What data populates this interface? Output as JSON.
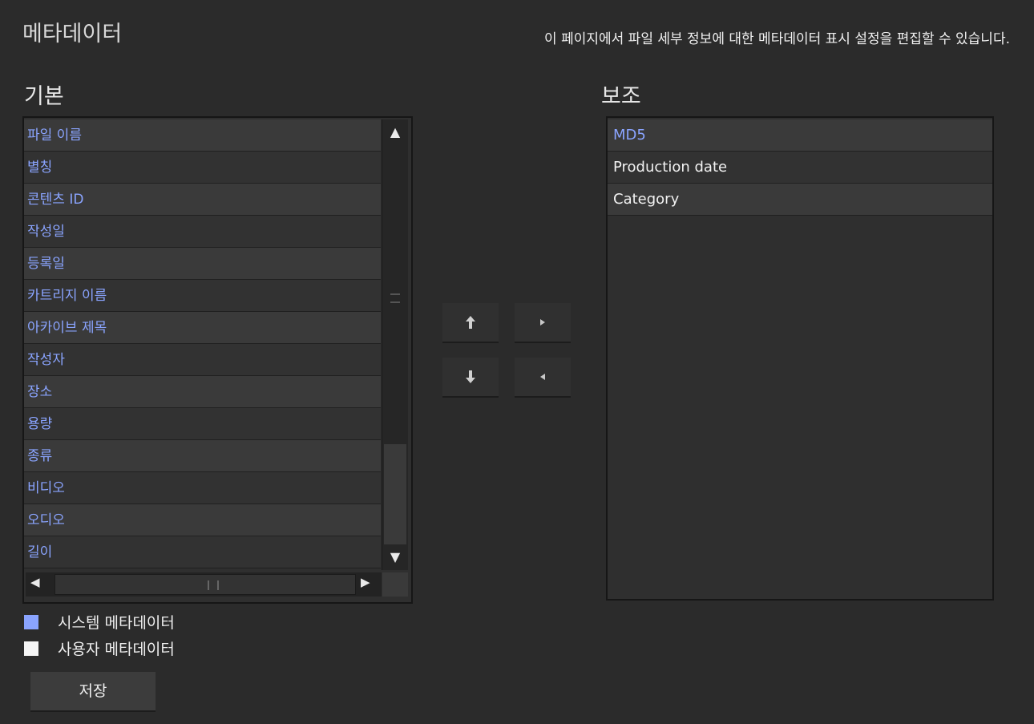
{
  "header": {
    "title": "메타데이터",
    "description": "이 페이지에서 파일 세부 정보에 대한 메타데이터 표시 설정을 편집할 수 있습니다."
  },
  "primary": {
    "label": "기본",
    "items": [
      {
        "label": "파일 이름",
        "type": "system"
      },
      {
        "label": "별칭",
        "type": "system"
      },
      {
        "label": "콘텐츠 ID",
        "type": "system"
      },
      {
        "label": "작성일",
        "type": "system"
      },
      {
        "label": "등록일",
        "type": "system"
      },
      {
        "label": "카트리지 이름",
        "type": "system"
      },
      {
        "label": "아카이브 제목",
        "type": "system"
      },
      {
        "label": "작성자",
        "type": "system"
      },
      {
        "label": "장소",
        "type": "system"
      },
      {
        "label": "용량",
        "type": "system"
      },
      {
        "label": "종류",
        "type": "system"
      },
      {
        "label": "비디오",
        "type": "system"
      },
      {
        "label": "오디오",
        "type": "system"
      },
      {
        "label": "길이",
        "type": "system"
      }
    ]
  },
  "secondary": {
    "label": "보조",
    "items": [
      {
        "label": "MD5",
        "type": "system"
      },
      {
        "label": "Production date",
        "type": "user"
      },
      {
        "label": "Category",
        "type": "user"
      }
    ]
  },
  "legend": {
    "system": "시스템 메타데이터",
    "user": "사용자 메타데이터"
  },
  "buttons": {
    "save": "저장"
  },
  "colors": {
    "system_item": "#8aa4ff",
    "user_item": "#f2f2f2",
    "background": "#2b2b2b"
  },
  "icons": {
    "up": "arrow-up-icon",
    "down": "arrow-down-icon",
    "move_right": "move-right-icon",
    "move_left": "move-left-icon"
  }
}
